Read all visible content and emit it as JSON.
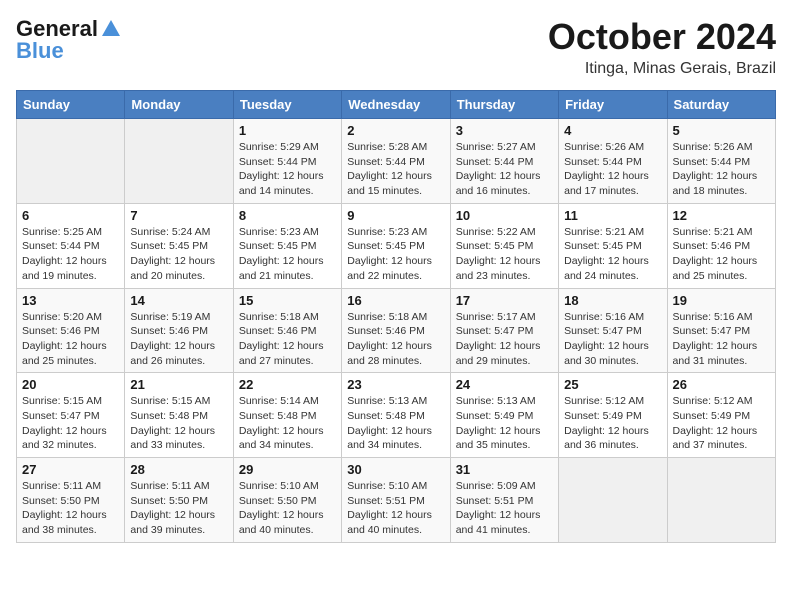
{
  "header": {
    "logo_line1": "General",
    "logo_line2": "Blue",
    "month": "October 2024",
    "location": "Itinga, Minas Gerais, Brazil"
  },
  "weekdays": [
    "Sunday",
    "Monday",
    "Tuesday",
    "Wednesday",
    "Thursday",
    "Friday",
    "Saturday"
  ],
  "weeks": [
    [
      {
        "day": "",
        "sunrise": "",
        "sunset": "",
        "daylight": ""
      },
      {
        "day": "",
        "sunrise": "",
        "sunset": "",
        "daylight": ""
      },
      {
        "day": "1",
        "sunrise": "Sunrise: 5:29 AM",
        "sunset": "Sunset: 5:44 PM",
        "daylight": "Daylight: 12 hours and 14 minutes."
      },
      {
        "day": "2",
        "sunrise": "Sunrise: 5:28 AM",
        "sunset": "Sunset: 5:44 PM",
        "daylight": "Daylight: 12 hours and 15 minutes."
      },
      {
        "day": "3",
        "sunrise": "Sunrise: 5:27 AM",
        "sunset": "Sunset: 5:44 PM",
        "daylight": "Daylight: 12 hours and 16 minutes."
      },
      {
        "day": "4",
        "sunrise": "Sunrise: 5:26 AM",
        "sunset": "Sunset: 5:44 PM",
        "daylight": "Daylight: 12 hours and 17 minutes."
      },
      {
        "day": "5",
        "sunrise": "Sunrise: 5:26 AM",
        "sunset": "Sunset: 5:44 PM",
        "daylight": "Daylight: 12 hours and 18 minutes."
      }
    ],
    [
      {
        "day": "6",
        "sunrise": "Sunrise: 5:25 AM",
        "sunset": "Sunset: 5:44 PM",
        "daylight": "Daylight: 12 hours and 19 minutes."
      },
      {
        "day": "7",
        "sunrise": "Sunrise: 5:24 AM",
        "sunset": "Sunset: 5:45 PM",
        "daylight": "Daylight: 12 hours and 20 minutes."
      },
      {
        "day": "8",
        "sunrise": "Sunrise: 5:23 AM",
        "sunset": "Sunset: 5:45 PM",
        "daylight": "Daylight: 12 hours and 21 minutes."
      },
      {
        "day": "9",
        "sunrise": "Sunrise: 5:23 AM",
        "sunset": "Sunset: 5:45 PM",
        "daylight": "Daylight: 12 hours and 22 minutes."
      },
      {
        "day": "10",
        "sunrise": "Sunrise: 5:22 AM",
        "sunset": "Sunset: 5:45 PM",
        "daylight": "Daylight: 12 hours and 23 minutes."
      },
      {
        "day": "11",
        "sunrise": "Sunrise: 5:21 AM",
        "sunset": "Sunset: 5:45 PM",
        "daylight": "Daylight: 12 hours and 24 minutes."
      },
      {
        "day": "12",
        "sunrise": "Sunrise: 5:21 AM",
        "sunset": "Sunset: 5:46 PM",
        "daylight": "Daylight: 12 hours and 25 minutes."
      }
    ],
    [
      {
        "day": "13",
        "sunrise": "Sunrise: 5:20 AM",
        "sunset": "Sunset: 5:46 PM",
        "daylight": "Daylight: 12 hours and 25 minutes."
      },
      {
        "day": "14",
        "sunrise": "Sunrise: 5:19 AM",
        "sunset": "Sunset: 5:46 PM",
        "daylight": "Daylight: 12 hours and 26 minutes."
      },
      {
        "day": "15",
        "sunrise": "Sunrise: 5:18 AM",
        "sunset": "Sunset: 5:46 PM",
        "daylight": "Daylight: 12 hours and 27 minutes."
      },
      {
        "day": "16",
        "sunrise": "Sunrise: 5:18 AM",
        "sunset": "Sunset: 5:46 PM",
        "daylight": "Daylight: 12 hours and 28 minutes."
      },
      {
        "day": "17",
        "sunrise": "Sunrise: 5:17 AM",
        "sunset": "Sunset: 5:47 PM",
        "daylight": "Daylight: 12 hours and 29 minutes."
      },
      {
        "day": "18",
        "sunrise": "Sunrise: 5:16 AM",
        "sunset": "Sunset: 5:47 PM",
        "daylight": "Daylight: 12 hours and 30 minutes."
      },
      {
        "day": "19",
        "sunrise": "Sunrise: 5:16 AM",
        "sunset": "Sunset: 5:47 PM",
        "daylight": "Daylight: 12 hours and 31 minutes."
      }
    ],
    [
      {
        "day": "20",
        "sunrise": "Sunrise: 5:15 AM",
        "sunset": "Sunset: 5:47 PM",
        "daylight": "Daylight: 12 hours and 32 minutes."
      },
      {
        "day": "21",
        "sunrise": "Sunrise: 5:15 AM",
        "sunset": "Sunset: 5:48 PM",
        "daylight": "Daylight: 12 hours and 33 minutes."
      },
      {
        "day": "22",
        "sunrise": "Sunrise: 5:14 AM",
        "sunset": "Sunset: 5:48 PM",
        "daylight": "Daylight: 12 hours and 34 minutes."
      },
      {
        "day": "23",
        "sunrise": "Sunrise: 5:13 AM",
        "sunset": "Sunset: 5:48 PM",
        "daylight": "Daylight: 12 hours and 34 minutes."
      },
      {
        "day": "24",
        "sunrise": "Sunrise: 5:13 AM",
        "sunset": "Sunset: 5:49 PM",
        "daylight": "Daylight: 12 hours and 35 minutes."
      },
      {
        "day": "25",
        "sunrise": "Sunrise: 5:12 AM",
        "sunset": "Sunset: 5:49 PM",
        "daylight": "Daylight: 12 hours and 36 minutes."
      },
      {
        "day": "26",
        "sunrise": "Sunrise: 5:12 AM",
        "sunset": "Sunset: 5:49 PM",
        "daylight": "Daylight: 12 hours and 37 minutes."
      }
    ],
    [
      {
        "day": "27",
        "sunrise": "Sunrise: 5:11 AM",
        "sunset": "Sunset: 5:50 PM",
        "daylight": "Daylight: 12 hours and 38 minutes."
      },
      {
        "day": "28",
        "sunrise": "Sunrise: 5:11 AM",
        "sunset": "Sunset: 5:50 PM",
        "daylight": "Daylight: 12 hours and 39 minutes."
      },
      {
        "day": "29",
        "sunrise": "Sunrise: 5:10 AM",
        "sunset": "Sunset: 5:50 PM",
        "daylight": "Daylight: 12 hours and 40 minutes."
      },
      {
        "day": "30",
        "sunrise": "Sunrise: 5:10 AM",
        "sunset": "Sunset: 5:51 PM",
        "daylight": "Daylight: 12 hours and 40 minutes."
      },
      {
        "day": "31",
        "sunrise": "Sunrise: 5:09 AM",
        "sunset": "Sunset: 5:51 PM",
        "daylight": "Daylight: 12 hours and 41 minutes."
      },
      {
        "day": "",
        "sunrise": "",
        "sunset": "",
        "daylight": ""
      },
      {
        "day": "",
        "sunrise": "",
        "sunset": "",
        "daylight": ""
      }
    ]
  ]
}
